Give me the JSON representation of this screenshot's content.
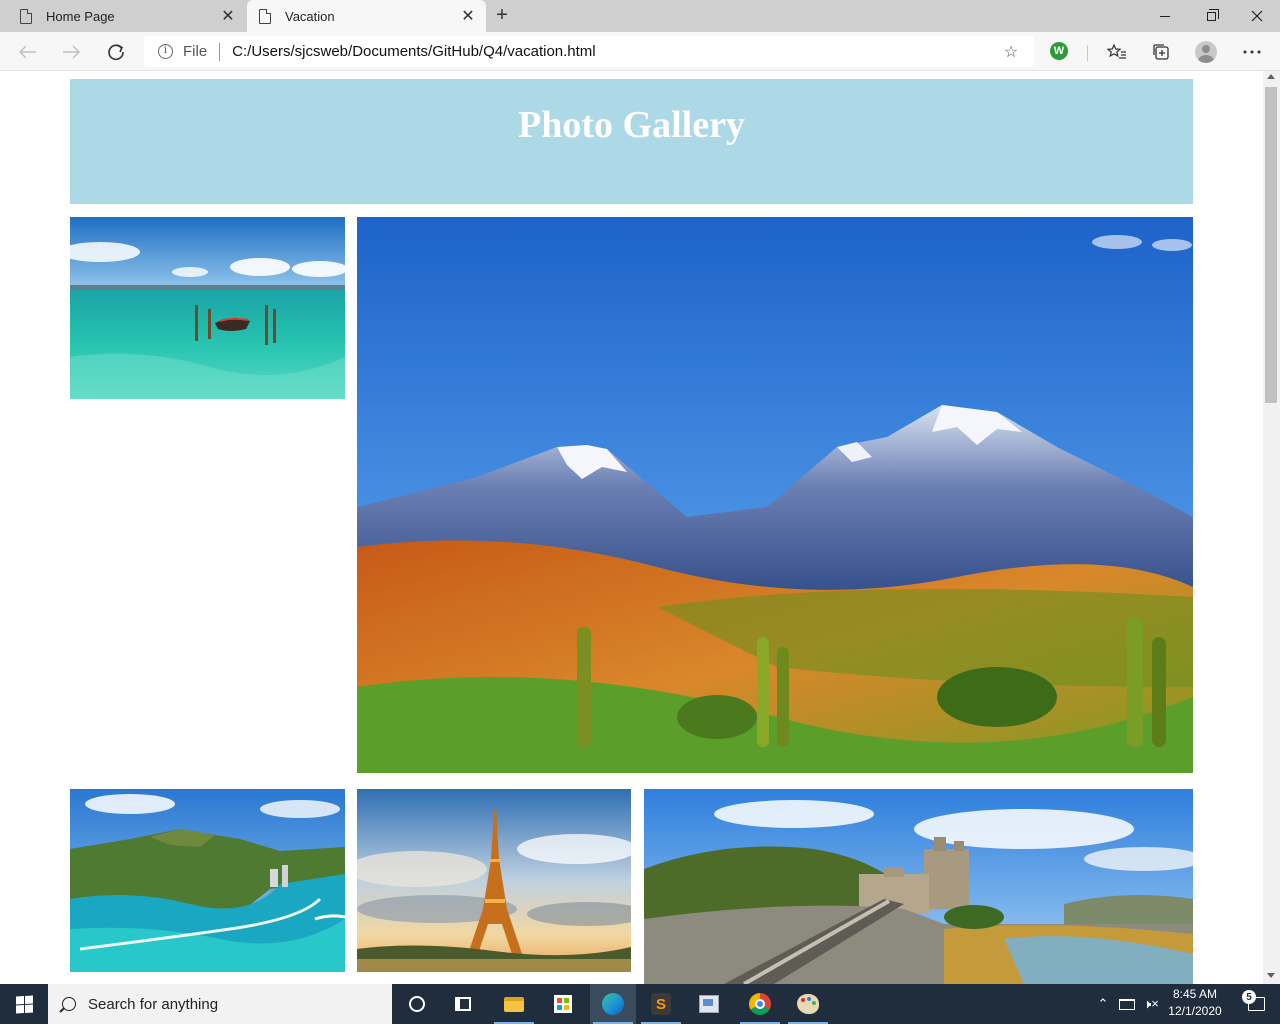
{
  "browser": {
    "tabs": [
      {
        "label": "Home Page",
        "active": false
      },
      {
        "label": "Vacation",
        "active": true
      }
    ],
    "new_tab_glyph": "+",
    "close_glyph": "✕",
    "address": {
      "scheme_label": "File",
      "url": "C:/Users/sjcsweb/Documents/GitHub/Q4/vacation.html"
    },
    "extension_badge": "W",
    "icons": [
      "back-arrow-icon",
      "forward-arrow-icon",
      "refresh-icon",
      "info-icon",
      "star-icon",
      "favorites-icon",
      "collections-icon",
      "profile-avatar",
      "more-icon"
    ]
  },
  "page": {
    "title": "Photo Gallery",
    "header_color": "#add8e6",
    "photos": [
      {
        "name": "tropical-sea-boat"
      },
      {
        "name": "snowy-mountains-valley"
      },
      {
        "name": "diamond-head-coast"
      },
      {
        "name": "eiffel-tower-sunset"
      },
      {
        "name": "scottish-castle-bridge"
      }
    ]
  },
  "taskbar": {
    "search_placeholder": "Search for anything",
    "time": "8:45 AM",
    "date": "12/1/2020",
    "notification_count": "5",
    "tray_chevron": "⌃",
    "volume_glyph": "🕨×",
    "apps": [
      "cortana-icon",
      "task-view-icon",
      "file-explorer-icon",
      "store-icon",
      "edge-icon",
      "sublime-text-icon",
      "paint-icon",
      "chrome-icon",
      "paint-3d-icon"
    ]
  }
}
